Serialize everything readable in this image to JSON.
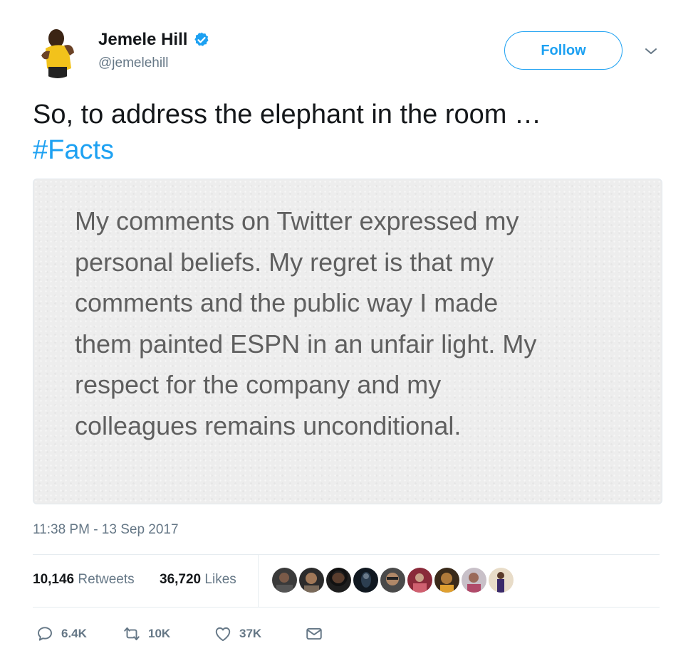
{
  "author": {
    "name": "Jemele Hill",
    "handle": "@jemelehill",
    "verified": true
  },
  "follow_label": "Follow",
  "tweet": {
    "text": "So, to address the elephant in the room …",
    "hashtag": "#Facts"
  },
  "image_text": [
    "My comments on Twitter expressed my",
    "personal beliefs.  My regret is that my",
    "comments and the public way I made",
    "them painted ESPN in an unfair light. My",
    "respect for the company and my",
    "colleagues remains unconditional."
  ],
  "timestamp": "11:38 PM - 13 Sep 2017",
  "stats": {
    "retweets_count": "10,146",
    "retweets_label": "Retweets",
    "likes_count": "36,720",
    "likes_label": "Likes"
  },
  "likers_count": 9,
  "actions": {
    "replies": "6.4K",
    "retweets": "10K",
    "likes": "37K"
  },
  "colors": {
    "accent": "#1da1f2",
    "secondary_text": "#657786",
    "primary_text": "#14171a"
  },
  "icons": [
    "verified-badge-icon",
    "chevron-down-icon",
    "reply-icon",
    "retweet-icon",
    "heart-icon",
    "envelope-icon"
  ]
}
